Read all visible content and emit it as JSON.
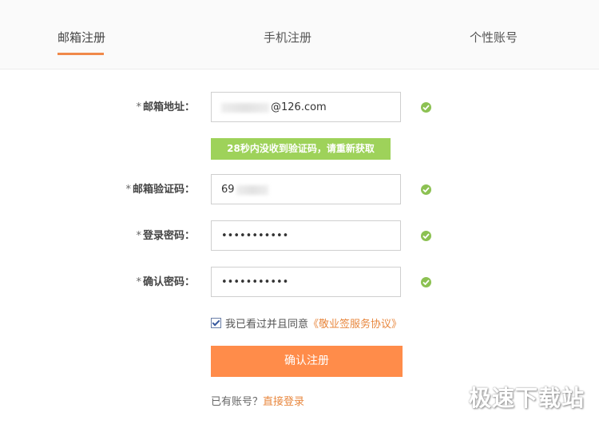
{
  "tabs": [
    {
      "label": "邮箱注册",
      "active": true
    },
    {
      "label": "手机注册",
      "active": false
    },
    {
      "label": "个性账号",
      "active": false
    }
  ],
  "form": {
    "email": {
      "star": "*",
      "label": "邮箱地址：",
      "value_suffix": "@126.com"
    },
    "resend_notice": "28秒内没收到验证码，请重新获取",
    "code": {
      "star": "*",
      "label": "邮箱验证码：",
      "value": "69"
    },
    "password": {
      "star": "*",
      "label": "登录密码：",
      "value": "•••••••••••"
    },
    "confirm": {
      "star": "*",
      "label": "确认密码：",
      "value": "•••••••••••"
    },
    "agree": {
      "checked": true,
      "text": "我已看过并且同意",
      "link": "《敬业签服务协议》"
    },
    "submit_label": "确认注册",
    "login": {
      "text": "已有账号？",
      "link": "直接登录"
    }
  },
  "watermark": "极速下载站",
  "colors": {
    "accent": "#ff8c4a",
    "valid": "#8cc152",
    "notice_bg": "#9ed25a",
    "link": "#e8873e"
  }
}
